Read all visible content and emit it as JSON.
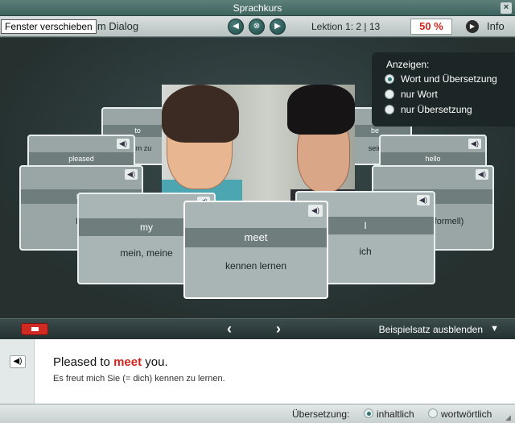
{
  "window": {
    "title": "Sprachkurs",
    "close": "×"
  },
  "toolbar": {
    "tooltip": "Fenster verschieben",
    "title_fragment": "r im Dialog",
    "nav": {
      "prev": "◀",
      "center": "⊗",
      "next": "▶"
    },
    "lesson": "Lektion 1:   2 | 13",
    "progress_percent": "50 %",
    "info_label": "Info"
  },
  "display_panel": {
    "header": "Anzeigen:",
    "options": [
      {
        "label": "Wort und Übersetzung",
        "selected": true
      },
      {
        "label": "nur Wort",
        "selected": false
      },
      {
        "label": "nur Übersetzung",
        "selected": false
      }
    ]
  },
  "cards": {
    "back_left_top": {
      "word": "to",
      "translation": "u, um zu"
    },
    "back_right_top": {
      "word": "be",
      "translation": "sein"
    },
    "mid_left": {
      "word": "pleased"
    },
    "mid_right": {
      "word": "hello"
    },
    "lower_left": {
      "word": "na",
      "translation": "Na"
    },
    "lower_right": {
      "translation": "formell)"
    },
    "front_my": {
      "word": "my",
      "translation": "mein, meine"
    },
    "front_meet": {
      "word": "meet",
      "translation": "kennen lernen"
    },
    "front_i": {
      "word": "I",
      "translation": "ich"
    }
  },
  "controls": {
    "left_arrow": "‹",
    "right_arrow": "›",
    "example_toggle": "Beispielsatz ausblenden",
    "toggle_icon": "▼"
  },
  "example": {
    "en_before": "Pleased to ",
    "en_highlight": "meet",
    "en_after": " you.",
    "de": "Es freut mich Sie (= dich) kennen zu lernen."
  },
  "footer": {
    "label": "Übersetzung:",
    "options": [
      {
        "label": "inhaltlich",
        "selected": true
      },
      {
        "label": "wortwörtlich",
        "selected": false
      }
    ]
  }
}
